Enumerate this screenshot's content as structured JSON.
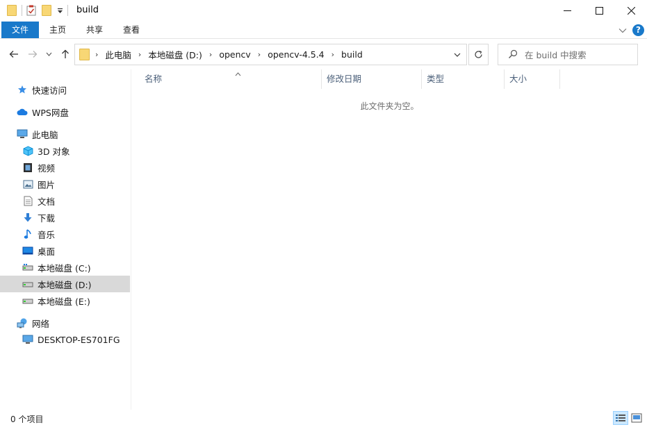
{
  "window": {
    "title": "build",
    "minimize_glyph": "—",
    "maximize_glyph": "□",
    "close_glyph": "✕"
  },
  "ribbon": {
    "tabs": [
      {
        "label": "文件"
      },
      {
        "label": "主页"
      },
      {
        "label": "共享"
      },
      {
        "label": "查看"
      }
    ],
    "help_glyph": "?"
  },
  "address": {
    "crumbs": [
      "此电脑",
      "本地磁盘 (D:)",
      "opencv",
      "opencv-4.5.4",
      "build"
    ],
    "separator": "›"
  },
  "search": {
    "placeholder": "在 build 中搜索"
  },
  "sidebar": {
    "items": [
      {
        "label": "快速访问",
        "icon": "star-icon"
      },
      {
        "label": "WPS网盘",
        "icon": "cloud-icon"
      },
      {
        "label": "此电脑",
        "icon": "computer-icon"
      },
      {
        "label": "3D 对象",
        "icon": "cube-icon"
      },
      {
        "label": "视频",
        "icon": "video-icon"
      },
      {
        "label": "图片",
        "icon": "picture-icon"
      },
      {
        "label": "文档",
        "icon": "document-icon"
      },
      {
        "label": "下载",
        "icon": "download-icon"
      },
      {
        "label": "音乐",
        "icon": "music-icon"
      },
      {
        "label": "桌面",
        "icon": "desktop-icon"
      },
      {
        "label": "本地磁盘 (C:)",
        "icon": "drive-icon"
      },
      {
        "label": "本地磁盘 (D:)",
        "icon": "drive-icon",
        "selected": true
      },
      {
        "label": "本地磁盘 (E:)",
        "icon": "drive-icon"
      },
      {
        "label": "网络",
        "icon": "network-icon"
      },
      {
        "label": "DESKTOP-ES701FG",
        "icon": "monitor-icon"
      }
    ]
  },
  "columns": [
    {
      "label": "名称"
    },
    {
      "label": "修改日期"
    },
    {
      "label": "类型"
    },
    {
      "label": "大小"
    }
  ],
  "content": {
    "empty_message": "此文件夹为空。"
  },
  "status": {
    "item_count": "0 个项目"
  },
  "colors": {
    "accent": "#1979ca",
    "selected_bg": "#d9d9d9",
    "folder": "#f8d775"
  }
}
